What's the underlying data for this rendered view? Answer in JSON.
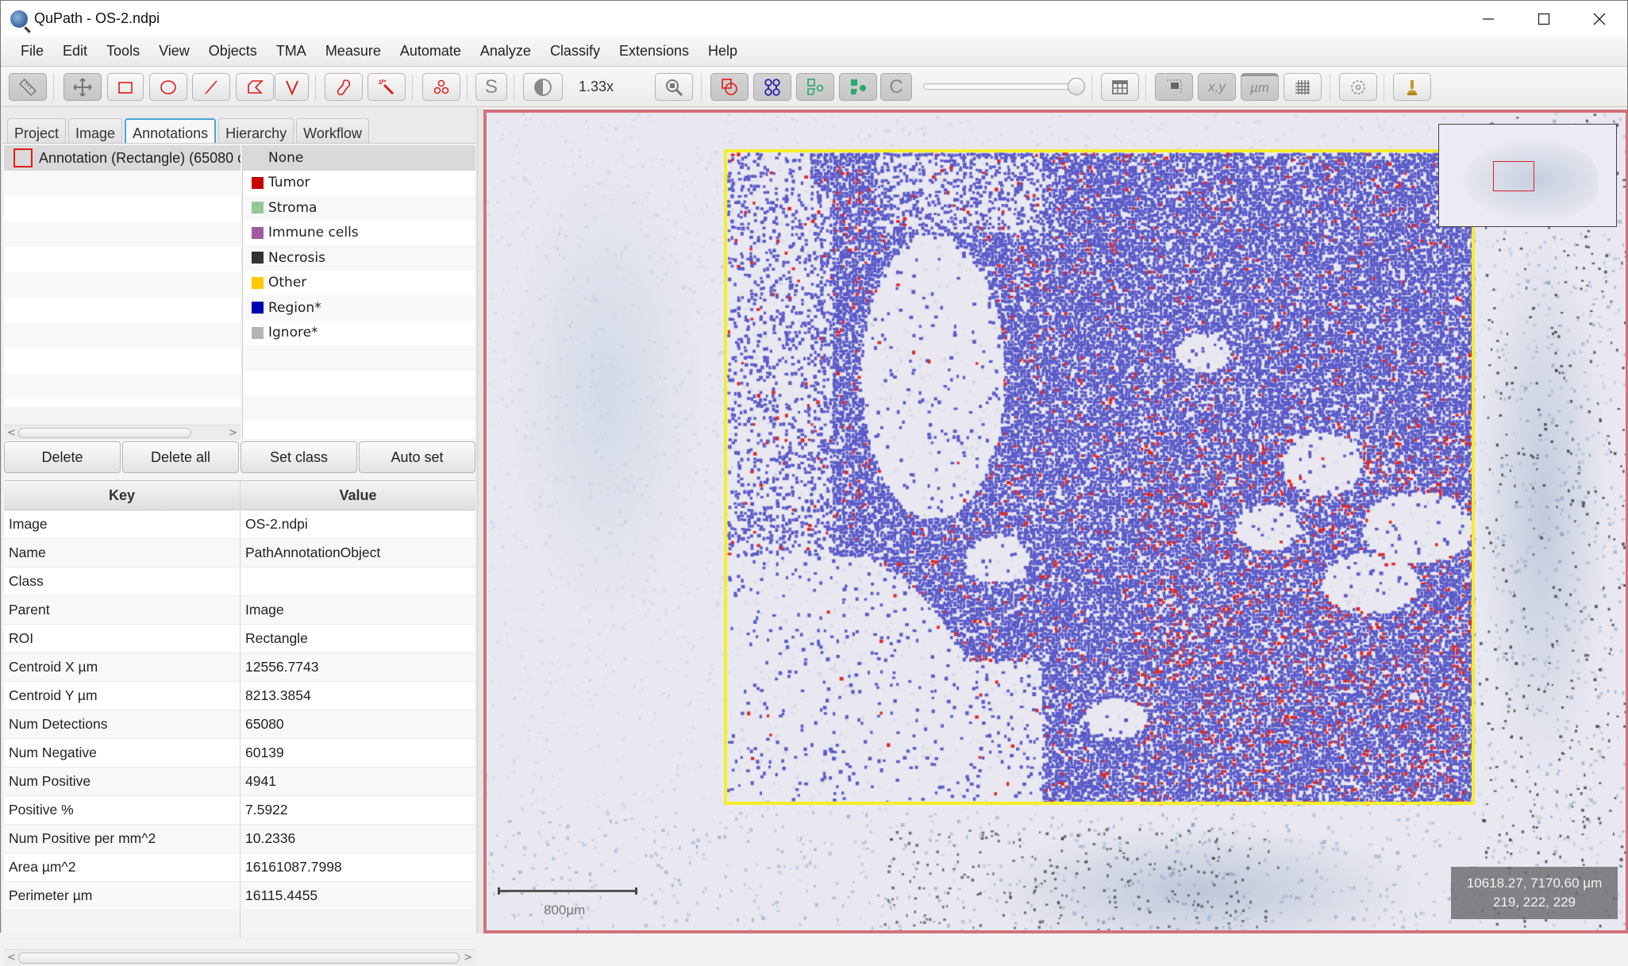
{
  "window": {
    "title": "QuPath - OS-2.ndpi",
    "controls": {
      "minimize": "—",
      "maximize": "☐",
      "close": "✕"
    }
  },
  "menu": [
    "File",
    "Edit",
    "Tools",
    "View",
    "Objects",
    "TMA",
    "Measure",
    "Automate",
    "Analyze",
    "Classify",
    "Extensions",
    "Help"
  ],
  "toolbar": {
    "zoom_level": "1.33x",
    "s_label": "S",
    "c_label": "C",
    "xy_label": "x,y",
    "um_label": "µm",
    "opacity_slider_value": 1.0
  },
  "left_panel": {
    "tabs": [
      {
        "label": "Project",
        "active": false
      },
      {
        "label": "Image",
        "active": false
      },
      {
        "label": "Annotations",
        "active": true
      },
      {
        "label": "Hierarchy",
        "active": false
      },
      {
        "label": "Workflow",
        "active": false
      }
    ],
    "annotations": [
      {
        "label": "Annotation (Rectangle) (65080 c",
        "color": "#e01b1b",
        "selected": true
      }
    ],
    "classes": [
      {
        "label": "None",
        "color": null,
        "selected": true
      },
      {
        "label": "Tumor",
        "color": "#c80000"
      },
      {
        "label": "Stroma",
        "color": "#96c896"
      },
      {
        "label": "Immune cells",
        "color": "#a05aa0"
      },
      {
        "label": "Necrosis",
        "color": "#323232"
      },
      {
        "label": "Other",
        "color": "#ffc800"
      },
      {
        "label": "Region*",
        "color": "#0000b4"
      },
      {
        "label": "Ignore*",
        "color": "#b4b4b4"
      }
    ],
    "buttons": {
      "delete": "Delete",
      "delete_all": "Delete all",
      "set_class": "Set class",
      "auto_set": "Auto set"
    },
    "properties": {
      "headers": {
        "key": "Key",
        "value": "Value"
      },
      "rows": [
        {
          "key": "Image",
          "value": "OS-2.ndpi"
        },
        {
          "key": "Name",
          "value": "PathAnnotationObject"
        },
        {
          "key": "Class",
          "value": ""
        },
        {
          "key": "Parent",
          "value": "Image"
        },
        {
          "key": "ROI",
          "value": "Rectangle"
        },
        {
          "key": "Centroid X µm",
          "value": "12556.7743"
        },
        {
          "key": "Centroid Y µm",
          "value": "8213.3854"
        },
        {
          "key": "Num Detections",
          "value": "65080"
        },
        {
          "key": "Num Negative",
          "value": "60139"
        },
        {
          "key": "Num Positive",
          "value": "4941"
        },
        {
          "key": "Positive %",
          "value": "7.5922"
        },
        {
          "key": "Num Positive per mm^2",
          "value": "10.2336"
        },
        {
          "key": "Area µm^2",
          "value": "16161087.7998"
        },
        {
          "key": "Perimeter µm",
          "value": "16115.4455"
        },
        {
          "key": "",
          "value": ""
        }
      ]
    }
  },
  "viewer": {
    "scalebar_label": "800µm",
    "cursor_position": "10618.27, 7170.60 µm",
    "cursor_rgb": "219, 222, 229",
    "colors": {
      "viewer_border": "#d0727a",
      "annotation_outline": "#f4ee29",
      "negative_detection": "#5a5ac8",
      "positive_detection": "#dc2828"
    }
  }
}
